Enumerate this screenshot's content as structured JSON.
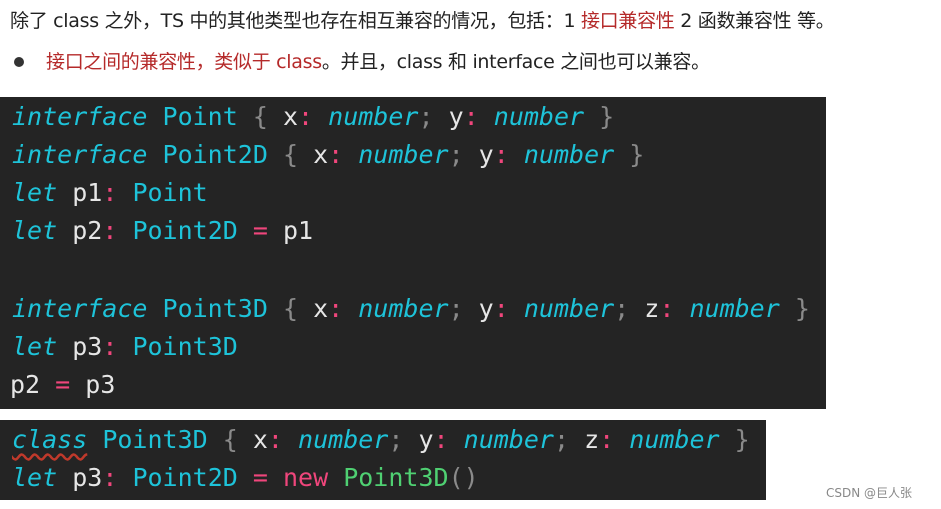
{
  "intro": {
    "text_a": "除了 class 之外，TS 中的其他类型也存在相互兼容的情况，包括：1 ",
    "highlight_a": "接口兼容性",
    "text_b": " 2 函数兼容性 等。"
  },
  "bullet": {
    "highlight": "接口之间的兼容性，类似于 class",
    "text": "。并且，class 和 interface 之间也可以兼容。"
  },
  "code_block_1": [
    [
      [
        "interface",
        "kw"
      ],
      [
        " ",
        "id"
      ],
      [
        "Point",
        "ty"
      ],
      [
        " ",
        "id"
      ],
      [
        "{",
        "br"
      ],
      [
        " x",
        "id"
      ],
      [
        ":",
        "op"
      ],
      [
        " ",
        "id"
      ],
      [
        "number",
        "kw"
      ],
      [
        ";",
        "br"
      ],
      [
        " y",
        "id"
      ],
      [
        ":",
        "op"
      ],
      [
        " ",
        "id"
      ],
      [
        "number",
        "kw"
      ],
      [
        " }",
        "br"
      ]
    ],
    [
      [
        "interface",
        "kw"
      ],
      [
        " ",
        "id"
      ],
      [
        "Point2D",
        "ty"
      ],
      [
        " ",
        "id"
      ],
      [
        "{",
        "br"
      ],
      [
        " x",
        "id"
      ],
      [
        ":",
        "op"
      ],
      [
        " ",
        "id"
      ],
      [
        "number",
        "kw"
      ],
      [
        ";",
        "br"
      ],
      [
        " y",
        "id"
      ],
      [
        ":",
        "op"
      ],
      [
        " ",
        "id"
      ],
      [
        "number",
        "kw"
      ],
      [
        " }",
        "br"
      ]
    ],
    [
      [
        "let",
        "kw"
      ],
      [
        " p1",
        "id"
      ],
      [
        ":",
        "op"
      ],
      [
        " ",
        "id"
      ],
      [
        "Point",
        "ty"
      ]
    ],
    [
      [
        "let",
        "kw"
      ],
      [
        " p2",
        "id"
      ],
      [
        ":",
        "op"
      ],
      [
        " ",
        "id"
      ],
      [
        "Point2D",
        "ty"
      ],
      [
        " ",
        "id"
      ],
      [
        "=",
        "op"
      ],
      [
        " p1",
        "id"
      ]
    ],
    [],
    [
      [
        "interface",
        "kw"
      ],
      [
        " ",
        "id"
      ],
      [
        "Point3D",
        "ty"
      ],
      [
        " ",
        "id"
      ],
      [
        "{",
        "br"
      ],
      [
        " x",
        "id"
      ],
      [
        ":",
        "op"
      ],
      [
        " ",
        "id"
      ],
      [
        "number",
        "kw"
      ],
      [
        ";",
        "br"
      ],
      [
        " y",
        "id"
      ],
      [
        ":",
        "op"
      ],
      [
        " ",
        "id"
      ],
      [
        "number",
        "kw"
      ],
      [
        ";",
        "br"
      ],
      [
        " z",
        "id"
      ],
      [
        ":",
        "op"
      ],
      [
        " ",
        "id"
      ],
      [
        "number",
        "kw"
      ],
      [
        " }",
        "br"
      ]
    ],
    [
      [
        "let",
        "kw"
      ],
      [
        " p3",
        "id"
      ],
      [
        ":",
        "op"
      ],
      [
        " ",
        "id"
      ],
      [
        "Point3D",
        "ty"
      ]
    ],
    [
      [
        "p2 ",
        "id"
      ],
      [
        "=",
        "op"
      ],
      [
        " p3",
        "id"
      ]
    ]
  ],
  "code_block_2": [
    [
      [
        "class",
        "kw sq"
      ],
      [
        " ",
        "id"
      ],
      [
        "Point3D",
        "ty"
      ],
      [
        " ",
        "id"
      ],
      [
        "{",
        "br"
      ],
      [
        " x",
        "id"
      ],
      [
        ":",
        "op"
      ],
      [
        " ",
        "id"
      ],
      [
        "number",
        "kw"
      ],
      [
        ";",
        "br"
      ],
      [
        " y",
        "id"
      ],
      [
        ":",
        "op"
      ],
      [
        " ",
        "id"
      ],
      [
        "number",
        "kw"
      ],
      [
        ";",
        "br"
      ],
      [
        " z",
        "id"
      ],
      [
        ":",
        "op"
      ],
      [
        " ",
        "id"
      ],
      [
        "number",
        "kw"
      ],
      [
        " }",
        "br"
      ]
    ],
    [
      [
        "let",
        "kw"
      ],
      [
        " p3",
        "id"
      ],
      [
        ":",
        "op"
      ],
      [
        " ",
        "id"
      ],
      [
        "Point2D",
        "ty"
      ],
      [
        " ",
        "id"
      ],
      [
        "=",
        "op"
      ],
      [
        " ",
        "id"
      ],
      [
        "new",
        "nw"
      ],
      [
        " ",
        "id"
      ],
      [
        "Point3D",
        "cl"
      ],
      [
        "()",
        "br"
      ]
    ]
  ],
  "watermark": "CSDN @巨人张",
  "colors": {
    "code_bg": "#242424",
    "keyword": "#1ec3d9",
    "operator": "#f0467c",
    "class_name": "#4fd072",
    "highlight_text": "#b52a2a"
  }
}
